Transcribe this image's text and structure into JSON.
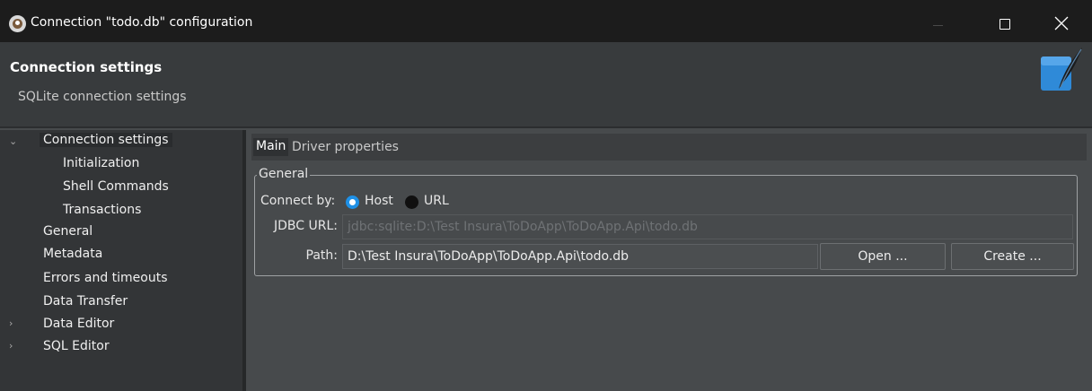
{
  "window": {
    "title": "Connection \"todo.db\" configuration",
    "icon": "dbeaver-beaver-icon"
  },
  "header": {
    "title": "Connection settings",
    "subtitle": "SQLite connection settings",
    "logo": "sqlite-feather-logo"
  },
  "nav": {
    "items": [
      {
        "label": "Connection settings",
        "level": 0,
        "expanded": true,
        "selected": true
      },
      {
        "label": "Initialization",
        "level": 1
      },
      {
        "label": "Shell Commands",
        "level": 1
      },
      {
        "label": "Transactions",
        "level": 1
      },
      {
        "label": "General",
        "level": 0
      },
      {
        "label": "Metadata",
        "level": 0
      },
      {
        "label": "Errors and timeouts",
        "level": 0
      },
      {
        "label": "Data Transfer",
        "level": 0
      },
      {
        "label": "Data Editor",
        "level": 0,
        "collapsible": true
      },
      {
        "label": "SQL Editor",
        "level": 0,
        "collapsible": true
      }
    ]
  },
  "tabs": [
    {
      "label": "Main",
      "active": true
    },
    {
      "label": "Driver properties",
      "active": false
    }
  ],
  "general": {
    "legend": "General",
    "connect_by_label": "Connect by:",
    "options": [
      {
        "label": "Host",
        "selected": true
      },
      {
        "label": "URL",
        "selected": false
      }
    ],
    "jdbc_label": "JDBC URL:",
    "jdbc_value": "jdbc:sqlite:D:\\Test Insura\\ToDoApp\\ToDoApp.Api\\todo.db",
    "path_label": "Path:",
    "path_value": "D:\\Test Insura\\ToDoApp\\ToDoApp.Api\\todo.db",
    "open_button": "Open ...",
    "create_button": "Create ..."
  },
  "colors": {
    "titlebar": "#1c1c1c",
    "header": "#383b3d",
    "nav": "#333537",
    "content": "#474a4c",
    "radio_accent": "#1e90e6",
    "logo_blue": "#2f8ad8"
  }
}
